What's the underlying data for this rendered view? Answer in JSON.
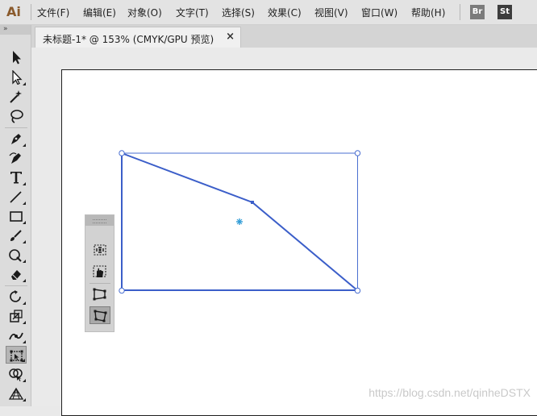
{
  "app": {
    "logo": "Ai"
  },
  "menu": {
    "items": [
      {
        "label": "文件(F)"
      },
      {
        "label": "编辑(E)"
      },
      {
        "label": "对象(O)"
      },
      {
        "label": "文字(T)"
      },
      {
        "label": "选择(S)"
      },
      {
        "label": "效果(C)"
      },
      {
        "label": "视图(V)"
      },
      {
        "label": "窗口(W)"
      },
      {
        "label": "帮助(H)"
      }
    ],
    "bridge_label": "Br",
    "stock_label": "St"
  },
  "document_tab": {
    "label": "未标题-1* @ 153% (CMYK/GPU 预览)",
    "close": "×"
  },
  "tools_panel": {
    "header": "»",
    "tools": [
      {
        "name": "selection-tool",
        "icon": "arrow-filled"
      },
      {
        "name": "direct-selection-tool",
        "icon": "arrow-hollow"
      },
      {
        "name": "magic-wand-tool",
        "icon": "magic-wand"
      },
      {
        "name": "lasso-tool",
        "icon": "lasso"
      },
      {
        "name": "pen-tool",
        "icon": "pen"
      },
      {
        "name": "curvature-tool",
        "icon": "pen-curve"
      },
      {
        "name": "type-tool",
        "icon": "T"
      },
      {
        "name": "line-segment-tool",
        "icon": "line"
      },
      {
        "name": "rectangle-tool",
        "icon": "rectangle"
      },
      {
        "name": "paintbrush-tool",
        "icon": "brush"
      },
      {
        "name": "shaper-tool",
        "icon": "shaper"
      },
      {
        "name": "eraser-tool",
        "icon": "eraser"
      },
      {
        "name": "rotate-tool",
        "icon": "rotate"
      },
      {
        "name": "scale-tool",
        "icon": "scale"
      },
      {
        "name": "width-tool",
        "icon": "width"
      },
      {
        "name": "free-transform-tool",
        "icon": "free-transform",
        "active": true
      },
      {
        "name": "shape-builder-tool",
        "icon": "shape-builder"
      },
      {
        "name": "perspective-grid-tool",
        "icon": "perspective-grid"
      }
    ]
  },
  "flyout": {
    "tools": [
      {
        "name": "free-transform-constrain-tool",
        "icon": "constrain"
      },
      {
        "name": "free-transform-tool-option",
        "icon": "hand-transform"
      },
      {
        "name": "perspective-distort-tool",
        "icon": "perspective-distort"
      },
      {
        "name": "free-distort-tool",
        "icon": "free-distort",
        "active": true
      }
    ]
  },
  "canvas": {
    "selection_color": "#4a6fd1",
    "shape_stroke_color": "#3b5ec9"
  },
  "watermark": "https://blog.csdn.net/qinheDSTX"
}
